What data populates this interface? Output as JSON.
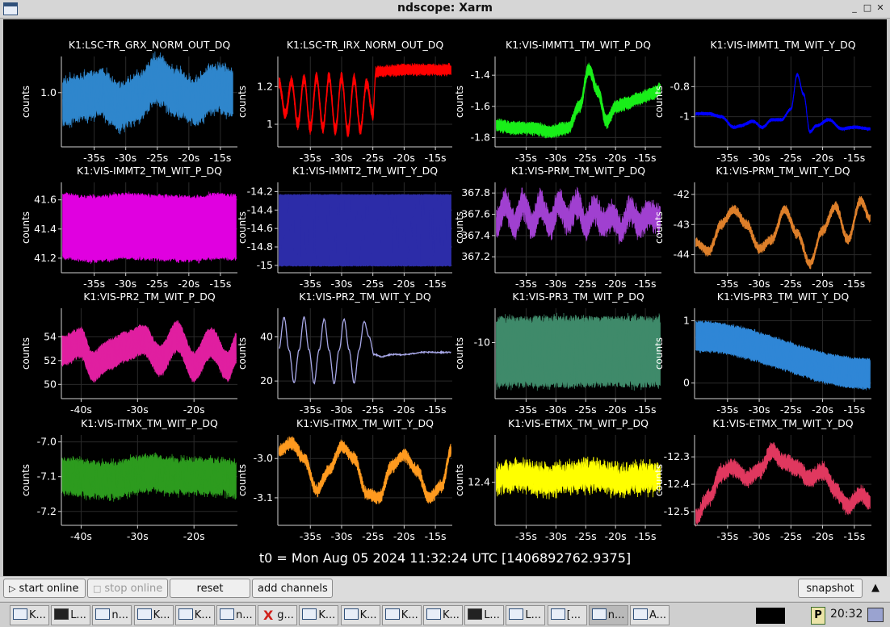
{
  "window": {
    "title": "ndscope: Xarm",
    "buttons": [
      "_",
      "□",
      "✕"
    ]
  },
  "t0_label": "t0 = Mon Aug 05 2024 11:32:24 UTC [1406892762.9375]",
  "controls": {
    "start_online": "start online",
    "stop_online": "stop online",
    "reset": "reset",
    "add_channels": "add channels",
    "snapshot": "snapshot",
    "menu_arrow": "▲"
  },
  "taskbar": {
    "tasks": [
      "K...",
      "L...",
      "n...",
      "K...",
      "K...",
      "n...",
      "g...",
      "K...",
      "K...",
      "K...",
      "K...",
      "L...",
      "L...",
      "[...",
      "n...",
      "A..."
    ],
    "clock": "20:32",
    "tray_p": "P"
  },
  "chart_data": [
    {
      "type": "line",
      "title": "K1:LSC-TR_GRX_NORM_OUT_DQ",
      "ylabel": "counts",
      "color": "#2f86cc",
      "yticks": [
        "1.0"
      ],
      "ytick_values": [
        1.0
      ],
      "ylim": [
        0.88,
        1.08
      ],
      "xticks": [
        "-35s",
        "-30s",
        "-25s",
        "-20s",
        "-15s"
      ],
      "xtick_values": [
        -35,
        -30,
        -25,
        -20,
        -15
      ],
      "xlim": [
        -40.2,
        -12.3
      ],
      "x": [
        -40,
        -37,
        -34,
        -31,
        -28,
        -25,
        -22,
        -19,
        -16,
        -13
      ],
      "y": [
        0.98,
        0.99,
        1.0,
        0.97,
        0.99,
        1.03,
        1.0,
        0.98,
        1.01,
        1.0
      ],
      "band": 0.035,
      "noise": 0.02
    },
    {
      "type": "line",
      "title": "K1:LSC-TR_IRX_NORM_OUT_DQ",
      "ylabel": "counts",
      "color": "#ff0000",
      "yticks": [
        "1.2",
        "1"
      ],
      "ytick_values": [
        1.2,
        1.0
      ],
      "ylim": [
        0.88,
        1.36
      ],
      "xticks": [
        "-35s",
        "-30s",
        "-25s",
        "-20s",
        "-15s"
      ],
      "xtick_values": [
        -35,
        -30,
        -25,
        -20,
        -15
      ],
      "xlim": [
        -40.2,
        -12.3
      ],
      "x": [
        -40,
        -39,
        -38,
        -37,
        -36,
        -35,
        -34,
        -33,
        -32,
        -31,
        -30,
        -29,
        -28,
        -27,
        -26,
        -25,
        -24.5,
        -20,
        -15,
        -12.5
      ],
      "y": [
        1.22,
        1.05,
        1.23,
        1.0,
        1.24,
        0.98,
        1.25,
        0.98,
        1.25,
        0.97,
        1.25,
        0.96,
        1.24,
        0.97,
        1.22,
        1.05,
        1.28,
        1.29,
        1.29,
        1.29
      ],
      "band": 0.015,
      "noise": 0.015
    },
    {
      "type": "line",
      "title": "K1:VIS-IMMT1_TM_WIT_P_DQ",
      "ylabel": "counts",
      "color": "#19ee19",
      "yticks": [
        "-1.4",
        "-1.6",
        "-1.8"
      ],
      "ytick_values": [
        -1.4,
        -1.6,
        -1.8
      ],
      "ylim": [
        -1.86,
        -1.28
      ],
      "xticks": [
        "-35s",
        "-30s",
        "-25s",
        "-20s",
        "-15s"
      ],
      "xtick_values": [
        -35,
        -30,
        -25,
        -20,
        -15
      ],
      "xlim": [
        -40.2,
        -12.3
      ],
      "x": [
        -40,
        -37,
        -34,
        -31,
        -28,
        -26,
        -24.5,
        -23,
        -21.5,
        -20,
        -18,
        -16,
        -14,
        -12.5
      ],
      "y": [
        -1.72,
        -1.74,
        -1.74,
        -1.76,
        -1.74,
        -1.6,
        -1.36,
        -1.5,
        -1.7,
        -1.6,
        -1.58,
        -1.55,
        -1.52,
        -1.49
      ],
      "band": 0.02,
      "noise": 0.02
    },
    {
      "type": "line",
      "title": "K1:VIS-IMMT1_TM_WIT_Y_DQ",
      "ylabel": "counts",
      "color": "#0000ff",
      "yticks": [
        "-0.8",
        "-1"
      ],
      "ytick_values": [
        -0.8,
        -1.0
      ],
      "ylim": [
        -1.2,
        -0.6
      ],
      "xticks": [
        "-35s",
        "-30s",
        "-25s",
        "-20s",
        "-15s"
      ],
      "xtick_values": [
        -35,
        -30,
        -25,
        -20,
        -15
      ],
      "xlim": [
        -40.2,
        -12.3
      ],
      "x": [
        -40,
        -38,
        -36,
        -34,
        -33,
        -31,
        -29.5,
        -28,
        -26.5,
        -25,
        -24,
        -23,
        -22,
        -21,
        -19,
        -17,
        -15,
        -12.5
      ],
      "y": [
        -0.98,
        -0.98,
        -1.0,
        -1.07,
        -1.06,
        -1.03,
        -1.07,
        -1.02,
        -1.02,
        -0.95,
        -0.72,
        -0.85,
        -1.1,
        -1.06,
        -1.02,
        -1.08,
        -1.07,
        -1.08
      ],
      "band": 0.005,
      "noise": 0.005
    },
    {
      "type": "line",
      "title": "K1:VIS-IMMT2_TM_WIT_P_DQ",
      "ylabel": "counts",
      "color": "#e000e0",
      "yticks": [
        "41.6",
        "41.4",
        "41.2"
      ],
      "ytick_values": [
        41.6,
        41.4,
        41.2
      ],
      "ylim": [
        41.1,
        41.72
      ],
      "xticks": [
        "-35s",
        "-30s",
        "-25s",
        "-20s",
        "-15s"
      ],
      "xtick_values": [
        -35,
        -30,
        -25,
        -20,
        -15
      ],
      "xlim": [
        -40.2,
        -12.3
      ],
      "x": [
        -40,
        -35,
        -30,
        -25,
        -20,
        -15,
        -12.5
      ],
      "y": [
        41.42,
        41.4,
        41.42,
        41.41,
        41.4,
        41.42,
        41.41
      ],
      "band": 0.2,
      "noise": 0.03
    },
    {
      "type": "line",
      "title": "K1:VIS-IMMT2_TM_WIT_Y_DQ",
      "ylabel": "counts",
      "color": "#2c2ca8",
      "yticks": [
        "-14.2",
        "-14.4",
        "-14.6",
        "-14.8",
        "-15"
      ],
      "ytick_values": [
        -14.2,
        -14.4,
        -14.6,
        -14.8,
        -15
      ],
      "ylim": [
        -15.08,
        -14.1
      ],
      "xticks": [
        "-35s",
        "-30s",
        "-25s",
        "-20s",
        "-15s"
      ],
      "xtick_values": [
        -35,
        -30,
        -25,
        -20,
        -15
      ],
      "xlim": [
        -40.2,
        -12.3
      ],
      "x": [
        -40,
        -30,
        -20,
        -12.5
      ],
      "y": [
        -14.62,
        -14.62,
        -14.62,
        -14.62
      ],
      "band": 0.38,
      "noise": 0.01
    },
    {
      "type": "line",
      "title": "K1:VIS-PRM_TM_WIT_P_DQ",
      "ylabel": "counts",
      "color": "#a040d0",
      "yticks": [
        "367.8",
        "367.6",
        "367.4",
        "367.2"
      ],
      "ytick_values": [
        367.8,
        367.6,
        367.4,
        367.2
      ],
      "ylim": [
        367.05,
        367.9
      ],
      "xticks": [
        "-35s",
        "-30s",
        "-25s",
        "-20s",
        "-15s"
      ],
      "xtick_values": [
        -35,
        -30,
        -25,
        -20,
        -15
      ],
      "xlim": [
        -40.2,
        -12.3
      ],
      "x": [
        -40,
        -38.5,
        -37,
        -35.5,
        -34,
        -32.5,
        -31,
        -29.5,
        -28,
        -26.5,
        -25,
        -23.5,
        -22,
        -20.5,
        -19,
        -17.5,
        -16,
        -14.5,
        -12.5
      ],
      "y": [
        367.5,
        367.7,
        367.5,
        367.7,
        367.5,
        367.7,
        367.5,
        367.7,
        367.55,
        367.7,
        367.5,
        367.65,
        367.5,
        367.6,
        367.45,
        367.65,
        367.5,
        367.6,
        367.55
      ],
      "band": 0.05,
      "noise": 0.08
    },
    {
      "type": "line",
      "title": "K1:VIS-PRM_TM_WIT_Y_DQ",
      "ylabel": "counts",
      "color": "#dd7f2a",
      "yticks": [
        "-42",
        "-43",
        "-44"
      ],
      "ytick_values": [
        -42,
        -43,
        -44
      ],
      "ylim": [
        -44.6,
        -41.6
      ],
      "xticks": [
        "-35s",
        "-30s",
        "-25s",
        "-20s",
        "-15s"
      ],
      "xtick_values": [
        -35,
        -30,
        -25,
        -20,
        -15
      ],
      "xlim": [
        -40.2,
        -12.3
      ],
      "x": [
        -40,
        -38,
        -36,
        -34,
        -32,
        -30,
        -28,
        -26,
        -24,
        -22,
        -20,
        -18,
        -16,
        -14,
        -12.5
      ],
      "y": [
        -43.6,
        -43.9,
        -43.0,
        -42.5,
        -43.0,
        -43.8,
        -43.5,
        -42.5,
        -43.3,
        -44.3,
        -43.2,
        -42.4,
        -43.5,
        -42.2,
        -42.8
      ],
      "band": 0.05,
      "noise": 0.1
    },
    {
      "type": "line",
      "title": "K1:VIS-PR2_TM_WIT_P_DQ",
      "ylabel": "counts",
      "color": "#e01fa0",
      "yticks": [
        "54",
        "52",
        "50"
      ],
      "ytick_values": [
        54,
        52,
        50
      ],
      "ylim": [
        48.8,
        56.4
      ],
      "xticks": [
        "-40s",
        "-30s",
        "-20s"
      ],
      "xtick_values": [
        -40,
        -30,
        -20
      ],
      "xlim": [
        -43.5,
        -12.3
      ],
      "x": [
        -43.5,
        -40,
        -38,
        -35,
        -32,
        -29,
        -26,
        -23,
        -20,
        -17,
        -14,
        -12.5
      ],
      "y": [
        52.8,
        53.5,
        51.5,
        52.5,
        53.2,
        53.8,
        52.0,
        54.0,
        51.5,
        53.5,
        51.5,
        53.0
      ],
      "band": 1.0,
      "noise": 0.3
    },
    {
      "type": "line",
      "title": "K1:VIS-PR2_TM_WIT_Y_DQ",
      "ylabel": "counts",
      "color": "#a8a8e8",
      "yticks": [
        "40",
        "20"
      ],
      "ytick_values": [
        40,
        20
      ],
      "ylim": [
        12,
        53
      ],
      "xticks": [
        "-35s",
        "-30s",
        "-25s",
        "-20s",
        "-15s"
      ],
      "xtick_values": [
        -35,
        -30,
        -25,
        -20,
        -15
      ],
      "xlim": [
        -40.2,
        -12.3
      ],
      "x": [
        -40,
        -39.2,
        -38.4,
        -37.6,
        -36.8,
        -36,
        -35.2,
        -34.4,
        -33.6,
        -32.8,
        -32,
        -31.2,
        -30.4,
        -29.6,
        -28.8,
        -28,
        -27.2,
        -26.4,
        -25.6,
        -24.8,
        -23.5,
        -22,
        -20,
        -17,
        -14,
        -12.5
      ],
      "y": [
        35,
        49,
        34,
        19,
        34,
        49,
        34,
        19,
        34,
        48,
        34,
        19,
        34,
        48,
        34,
        19,
        34,
        47,
        40,
        32,
        31,
        32,
        32,
        33,
        33,
        33
      ],
      "band": 0,
      "noise": 0.3
    },
    {
      "type": "line",
      "title": "K1:VIS-PR3_TM_WIT_P_DQ",
      "ylabel": "counts",
      "color": "#3f8a6a",
      "yticks": [
        "-10"
      ],
      "ytick_values": [
        -10
      ],
      "ylim": [
        -11.8,
        -8.9
      ],
      "xticks": [
        "-35s",
        "-30s",
        "-25s",
        "-20s",
        "-15s"
      ],
      "xtick_values": [
        -35,
        -30,
        -25,
        -20,
        -15
      ],
      "xlim": [
        -40.2,
        -12.3
      ],
      "x": [
        -40,
        -30,
        -20,
        -12.5
      ],
      "y": [
        -10.3,
        -10.3,
        -10.3,
        -10.3
      ],
      "band": 0.9,
      "noise": 0.25
    },
    {
      "type": "line",
      "title": "K1:VIS-PR3_TM_WIT_Y_DQ",
      "ylabel": "counts",
      "color": "#2f86d6",
      "yticks": [
        "1",
        "0"
      ],
      "ytick_values": [
        1,
        0
      ],
      "ylim": [
        -0.25,
        1.2
      ],
      "xticks": [
        "-35s",
        "-30s",
        "-25s",
        "-20s",
        "-15s"
      ],
      "xtick_values": [
        -35,
        -30,
        -25,
        -20,
        -15
      ],
      "xlim": [
        -40.2,
        -12.3
      ],
      "x": [
        -40,
        -12.5
      ],
      "y": [
        0.75,
        0.15
      ],
      "band": 0.2,
      "noise": 0.05
    },
    {
      "type": "line",
      "title": "K1:VIS-ITMX_TM_WIT_P_DQ",
      "ylabel": "counts",
      "color": "#2d9b1e",
      "yticks": [
        "-7.0",
        "-7.1",
        "-7.2"
      ],
      "ytick_values": [
        -7.0,
        -7.1,
        -7.2
      ],
      "ylim": [
        -7.24,
        -6.98
      ],
      "xticks": [
        "-40s",
        "-30s",
        "-20s"
      ],
      "xtick_values": [
        -40,
        -30,
        -20
      ],
      "xlim": [
        -43.5,
        -12.3
      ],
      "x": [
        -43.5,
        -35,
        -28,
        -22,
        -15,
        -12.5
      ],
      "y": [
        -7.1,
        -7.11,
        -7.09,
        -7.1,
        -7.1,
        -7.11
      ],
      "band": 0.035,
      "noise": 0.02
    },
    {
      "type": "line",
      "title": "K1:VIS-ITMX_TM_WIT_Y_DQ",
      "ylabel": "counts",
      "color": "#ff9a1f",
      "yticks": [
        "-3.0",
        "-3.1"
      ],
      "ytick_values": [
        -3.0,
        -3.1
      ],
      "ylim": [
        -3.17,
        -2.94
      ],
      "xticks": [
        "-35s",
        "-30s",
        "-25s",
        "-20s",
        "-15s"
      ],
      "xtick_values": [
        -35,
        -30,
        -25,
        -20,
        -15
      ],
      "xlim": [
        -40.2,
        -12.3
      ],
      "x": [
        -40,
        -38,
        -36,
        -34,
        -32,
        -30,
        -28,
        -26,
        -24,
        -22,
        -20,
        -18,
        -16,
        -14,
        -12.5
      ],
      "y": [
        -2.98,
        -2.96,
        -3.0,
        -3.08,
        -3.03,
        -2.97,
        -3.0,
        -3.09,
        -3.1,
        -3.02,
        -2.99,
        -3.03,
        -3.1,
        -3.07,
        -2.98
      ],
      "band": 0.005,
      "noise": 0.01
    },
    {
      "type": "line",
      "title": "K1:VIS-ETMX_TM_WIT_P_DQ",
      "ylabel": "counts",
      "color": "#ffff00",
      "yticks": [
        "12.4"
      ],
      "ytick_values": [
        12.4
      ],
      "ylim": [
        12.2,
        12.62
      ],
      "xticks": [
        "-35s",
        "-30s",
        "-25s",
        "-20s",
        "-15s"
      ],
      "xtick_values": [
        -35,
        -30,
        -25,
        -20,
        -15
      ],
      "xlim": [
        -40.2,
        -12.3
      ],
      "x": [
        -40,
        -36,
        -32,
        -28,
        -24,
        -20,
        -16,
        -12.5
      ],
      "y": [
        12.42,
        12.43,
        12.41,
        12.42,
        12.43,
        12.41,
        12.42,
        12.42
      ],
      "band": 0.02,
      "noise": 0.05
    },
    {
      "type": "line",
      "title": "K1:VIS-ETMX_TM_WIT_Y_DQ",
      "ylabel": "counts",
      "color": "#e0385f",
      "yticks": [
        "-12.3",
        "-12.4",
        "-12.5"
      ],
      "ytick_values": [
        -12.3,
        -12.4,
        -12.5
      ],
      "ylim": [
        -12.55,
        -12.22
      ],
      "xticks": [
        "-35s",
        "-30s",
        "-25s",
        "-20s",
        "-15s"
      ],
      "xtick_values": [
        -35,
        -30,
        -25,
        -20,
        -15
      ],
      "xlim": [
        -40.2,
        -12.3
      ],
      "x": [
        -40,
        -38,
        -36,
        -34,
        -32,
        -30,
        -28,
        -26,
        -24,
        -22,
        -20,
        -18,
        -16,
        -14,
        -12.5
      ],
      "y": [
        -12.52,
        -12.45,
        -12.36,
        -12.34,
        -12.38,
        -12.35,
        -12.28,
        -12.32,
        -12.34,
        -12.38,
        -12.35,
        -12.42,
        -12.48,
        -12.44,
        -12.46
      ],
      "band": 0.01,
      "noise": 0.02
    }
  ]
}
